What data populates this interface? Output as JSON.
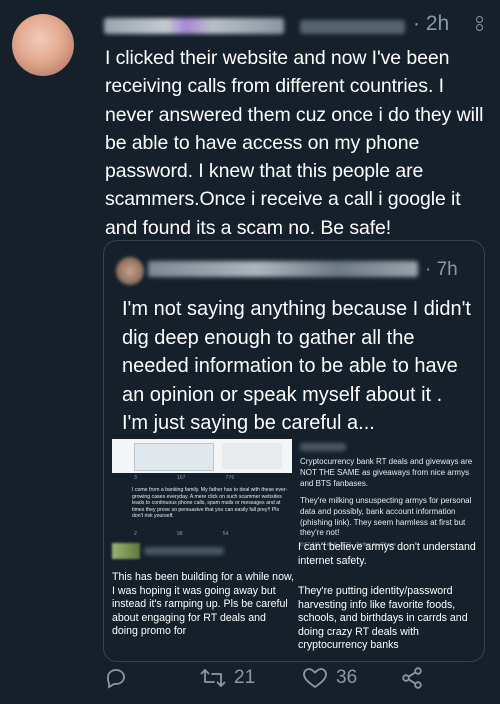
{
  "tweet": {
    "time": "· 2h",
    "text": "I clicked their website and now I've been receiving calls from different countries. I never answered them cuz once i do they will be able to have access on my phone password. I knew that this people are scammers.Once i receive a call i google it and found its a scam no. Be safe!"
  },
  "quoted": {
    "time": "· 7h",
    "text": "I'm not saying anything because I didn't dig deep enough to gather all the needed information to be able to have an opinion or speak myself about it . I'm just saying be careful a..."
  },
  "collage": {
    "top_right": "Cryptocurrency bank RT deals and giveways are NOT THE SAME as giveaways from nice armys and BTS fanbases.",
    "top_right_2": "They're milking unsuspecting armys for personal data and possibly, bank account information (phishing link). They seem harmless at first but they're not!",
    "top_right_meta": "8:57 AM · Feb 6, 2021 · Twitter for iPhone",
    "top_left_stats": [
      "3",
      "167",
      "776"
    ],
    "mid_left": "I come from a banking family. My father has to deal with these ever-growing cases everyday. A mere click on such scammer websites leads to continuous phone calls, spam mails or messages and at times they prove so persuasive that you can easily fall prey!! Pls don't risk yourself.",
    "mid_left_stats": [
      "2",
      "98",
      "54"
    ],
    "bottom_left": "This has been building for a while now, I was hoping it was going away but instead it's ramping up. Pls be careful about engaging for RT deals and doing promo for",
    "bottom_right_head": "I can't believe armys don't understand internet safety.",
    "bottom_right": "They're putting identity/password harvesting info like favorite foods, schools, and birthdays in carrds and doing crazy RT deals with cryptocurrency banks"
  },
  "actions": {
    "retweets": "21",
    "likes": "36"
  },
  "colors": {
    "background": "#15202b",
    "muted": "#8b98a5",
    "border": "#38444d"
  }
}
